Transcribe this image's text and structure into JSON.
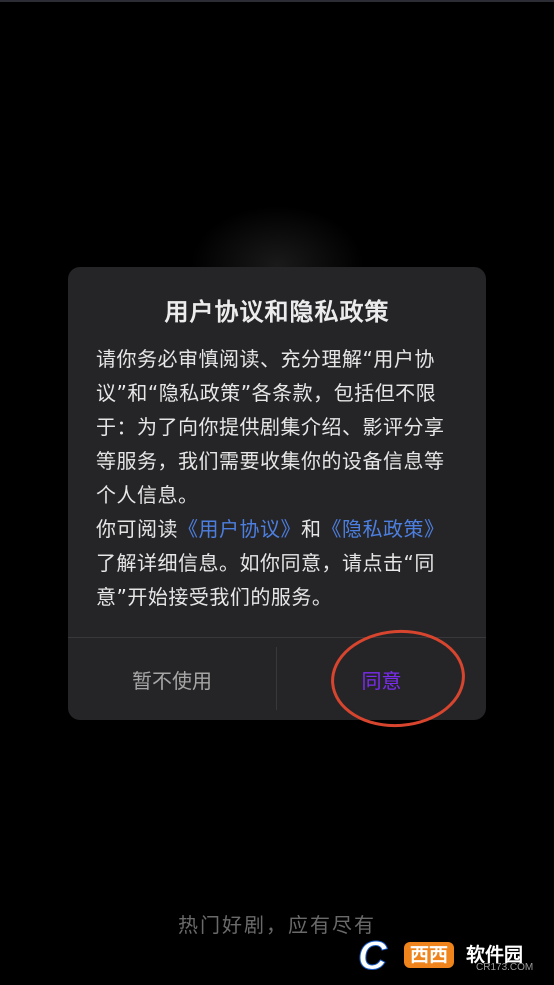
{
  "dialog": {
    "title": "用户协议和隐私政策",
    "paragraph1": "请你务必审慎阅读、充分理解“用户协议”和“隐私政策”各条款，包括但不限于：为了向你提供剧集介绍、影评分享等服务，我们需要收集你的设备信息等个人信息。",
    "p2_prefix": "你可阅读",
    "user_agreement_link": "《用户协议》",
    "p2_and": "和",
    "privacy_policy_link": "《隐私政策》",
    "p2_suffix": "了解详细信息。如你同意，请点击“同意”开始接受我们的服务。",
    "decline_label": "暂不使用",
    "agree_label": "同意"
  },
  "slogan": "热门好剧，应有尽有",
  "watermark": {
    "badge": "西西",
    "name": "软件园",
    "url": "CR173.COM"
  },
  "colors": {
    "background": "#000000",
    "dialog_bg": "#252528",
    "link": "#4d7fe0",
    "agree": "#7b2cf0",
    "annotation_circle": "#d8452e"
  }
}
